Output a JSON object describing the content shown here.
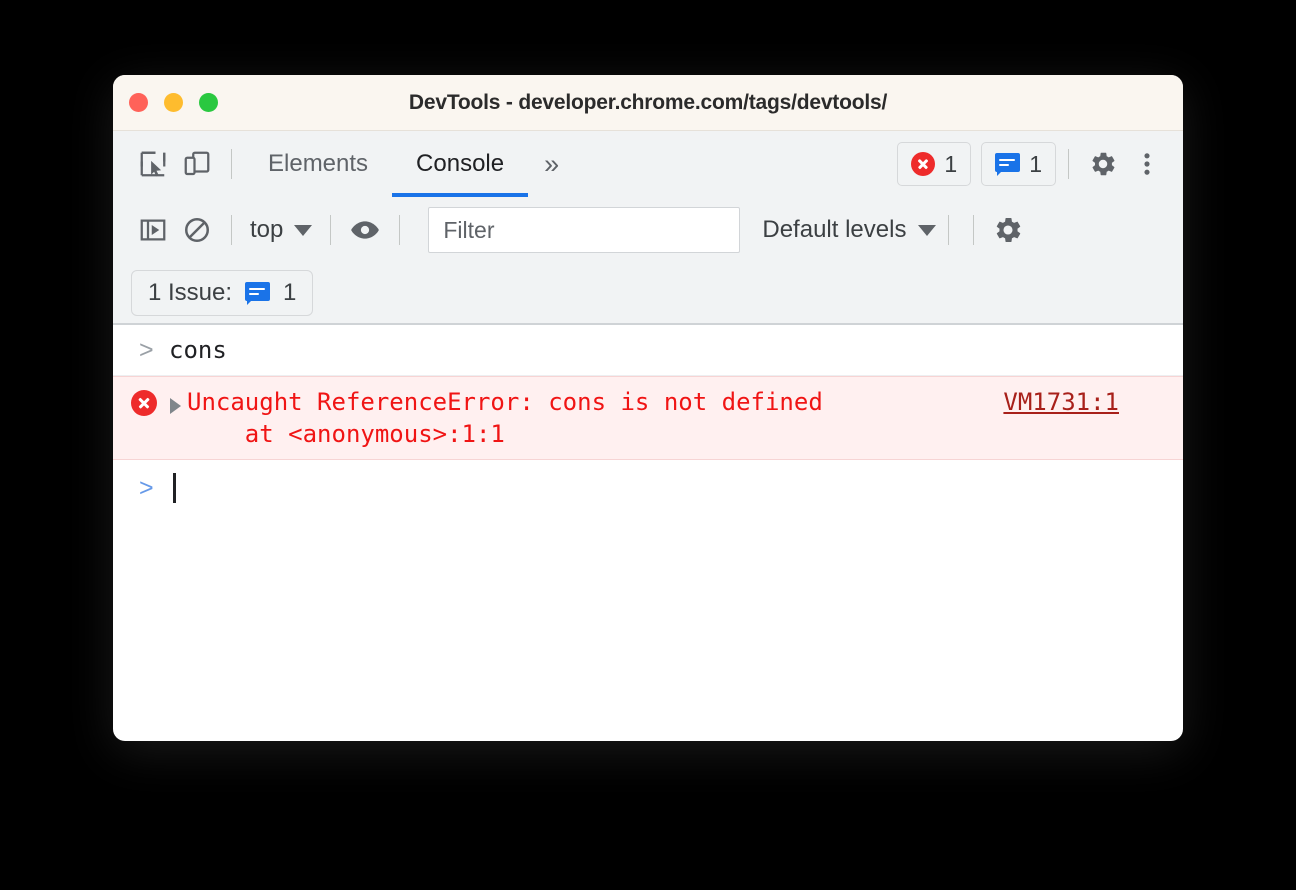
{
  "window": {
    "title": "DevTools - developer.chrome.com/tags/devtools/",
    "traffic_lights": [
      "close",
      "minimize",
      "maximize"
    ],
    "colors": {
      "titlebar_bg": "#faf6f0",
      "toolbar_bg": "#f1f3f4",
      "accent_blue": "#1a73e8",
      "error_red": "#f01414",
      "error_row_bg": "#fff0f0",
      "light_red": "#ff6259",
      "light_yellow": "#febc2e",
      "light_green": "#2ac840"
    }
  },
  "main_toolbar": {
    "inspect_icon": "inspect-cursor-icon",
    "device_icon": "device-toolbar-icon",
    "tabs": [
      {
        "label": "Elements",
        "active": false
      },
      {
        "label": "Console",
        "active": true
      }
    ],
    "more_tabs_label": "»",
    "error_badge": {
      "icon": "error-circle-icon",
      "count": "1"
    },
    "issues_badge": {
      "icon": "issue-bubble-icon",
      "count": "1"
    },
    "settings_icon": "gear-icon",
    "more_options_icon": "kebab-menu-icon"
  },
  "filter_toolbar": {
    "sidebar_toggle_icon": "console-sidebar-icon",
    "clear_console_icon": "clear-console-icon",
    "context_selector": {
      "value": "top",
      "caret": "chevron-down-icon"
    },
    "live_expression_icon": "eye-icon",
    "filter": {
      "placeholder": "Filter",
      "value": ""
    },
    "log_levels": {
      "value": "Default levels",
      "caret": "chevron-down-icon"
    },
    "settings_icon": "gear-icon"
  },
  "issues_bar": {
    "label": "1 Issue:",
    "icon": "issue-bubble-icon",
    "count": "1"
  },
  "console": {
    "entries": [
      {
        "type": "input",
        "prompt": ">",
        "text": "cons"
      },
      {
        "type": "error",
        "icon": "error-circle-icon",
        "disclosure": "collapsed-triangle-icon",
        "message_line1": "Uncaught ReferenceError: cons is not defined",
        "message_line2": "    at <anonymous>:1:1",
        "source_link": "VM1731:1"
      },
      {
        "type": "prompt",
        "prompt": ">",
        "text": ""
      }
    ]
  }
}
